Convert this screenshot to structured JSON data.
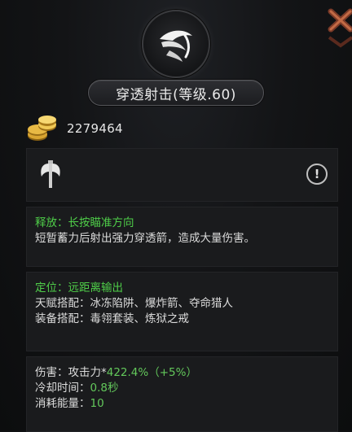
{
  "skill": {
    "title": "穿透射击(等级.60)",
    "icon": "arrow-skill-icon"
  },
  "gold": {
    "icon": "gold-coins-icon",
    "amount": "2279464"
  },
  "weapon": {
    "icon": "axe-icon",
    "info_icon": "info-icon",
    "info_glyph": "!"
  },
  "release": {
    "label": "释放：长按瞄准方向",
    "description": "短暂蓄力后射出强力穿透箭，造成大量伤害。"
  },
  "role": {
    "position": "定位：远距离输出",
    "talent_label": "天赋搭配：",
    "talent_value": "冰冻陷阱、爆炸箭、夺命猎人",
    "gear_label": "装备搭配：",
    "gear_value": "毒翎套装、炼狱之戒"
  },
  "stats": {
    "damage_label": "伤害：攻击力*",
    "damage_value": "422.4%",
    "damage_bonus": "（+5%）",
    "cooldown_label": "冷却时间：",
    "cooldown_value": "0.8秒",
    "energy_label": "消耗能量：",
    "energy_value": "10"
  },
  "colors": {
    "highlight_green": "#4fcf49",
    "panel_bg": "#1a1b1d",
    "page_bg": "#101113"
  }
}
